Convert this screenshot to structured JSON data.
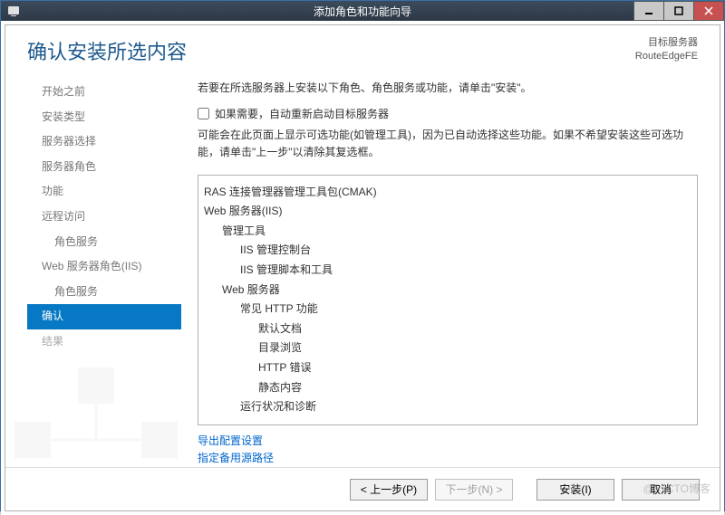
{
  "window": {
    "title": "添加角色和功能向导"
  },
  "header": {
    "page_title": "确认安装所选内容",
    "dest_label": "目标服务器",
    "dest_value": "RouteEdgeFE"
  },
  "sidebar": {
    "items": [
      {
        "label": "开始之前",
        "indent": false,
        "state": "past"
      },
      {
        "label": "安装类型",
        "indent": false,
        "state": "past"
      },
      {
        "label": "服务器选择",
        "indent": false,
        "state": "past"
      },
      {
        "label": "服务器角色",
        "indent": false,
        "state": "past"
      },
      {
        "label": "功能",
        "indent": false,
        "state": "past"
      },
      {
        "label": "远程访问",
        "indent": false,
        "state": "past"
      },
      {
        "label": "角色服务",
        "indent": true,
        "state": "past"
      },
      {
        "label": "Web 服务器角色(IIS)",
        "indent": false,
        "state": "past"
      },
      {
        "label": "角色服务",
        "indent": true,
        "state": "past"
      },
      {
        "label": "确认",
        "indent": false,
        "state": "active"
      },
      {
        "label": "结果",
        "indent": false,
        "state": "future"
      }
    ]
  },
  "main": {
    "instruction": "若要在所选服务器上安装以下角色、角色服务或功能，请单击\"安装\"。",
    "checkbox_label": "如果需要，自动重新启动目标服务器",
    "note": "可能会在此页面上显示可选功能(如管理工具)，因为已自动选择这些功能。如果不希望安装这些可选功能，请单击\"上一步\"以清除其复选框。",
    "list": [
      {
        "label": "RAS 连接管理器管理工具包(CMAK)",
        "indent": 1
      },
      {
        "label": "Web 服务器(IIS)",
        "indent": 1
      },
      {
        "label": "管理工具",
        "indent": 2
      },
      {
        "label": "IIS 管理控制台",
        "indent": 3
      },
      {
        "label": "IIS 管理脚本和工具",
        "indent": 3
      },
      {
        "label": "Web 服务器",
        "indent": 2
      },
      {
        "label": "常见 HTTP 功能",
        "indent": 3
      },
      {
        "label": "默认文档",
        "indent": 4
      },
      {
        "label": "目录浏览",
        "indent": 4
      },
      {
        "label": "HTTP 错误",
        "indent": 4
      },
      {
        "label": "静态内容",
        "indent": 4
      },
      {
        "label": "运行状况和诊断",
        "indent": 3
      }
    ],
    "link_export": "导出配置设置",
    "link_altsrc": "指定备用源路径"
  },
  "footer": {
    "prev": "< 上一步(P)",
    "next": "下一步(N) >",
    "install": "安装(I)",
    "cancel": "取消"
  },
  "watermark": "@51CTO博客"
}
